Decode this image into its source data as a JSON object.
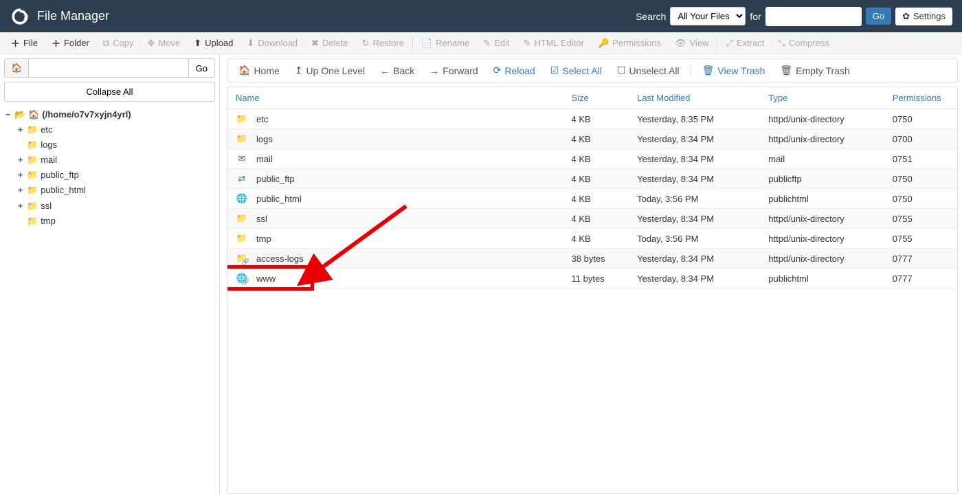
{
  "header": {
    "title": "File Manager",
    "searchLabel": "Search",
    "searchScope": "All Your Files",
    "forLabel": "for",
    "goLabel": "Go",
    "settingsLabel": "Settings"
  },
  "toolbar": {
    "file": "File",
    "folder": "Folder",
    "copy": "Copy",
    "move": "Move",
    "upload": "Upload",
    "download": "Download",
    "delete": "Delete",
    "restore": "Restore",
    "rename": "Rename",
    "edit": "Edit",
    "htmlEditor": "HTML Editor",
    "permissions": "Permissions",
    "view": "View",
    "extract": "Extract",
    "compress": "Compress"
  },
  "sidebar": {
    "goLabel": "Go",
    "collapseLabel": "Collapse All",
    "rootLabel": "(/home/o7v7xyjn4yrl)",
    "tree": [
      {
        "label": "etc",
        "expandable": true
      },
      {
        "label": "logs",
        "expandable": false
      },
      {
        "label": "mail",
        "expandable": true
      },
      {
        "label": "public_ftp",
        "expandable": true
      },
      {
        "label": "public_html",
        "expandable": true
      },
      {
        "label": "ssl",
        "expandable": true
      },
      {
        "label": "tmp",
        "expandable": false
      }
    ]
  },
  "nav": {
    "home": "Home",
    "upOne": "Up One Level",
    "back": "Back",
    "forward": "Forward",
    "reload": "Reload",
    "selectAll": "Select All",
    "unselectAll": "Unselect All",
    "viewTrash": "View Trash",
    "emptyTrash": "Empty Trash"
  },
  "columns": {
    "name": "Name",
    "size": "Size",
    "lastModified": "Last Modified",
    "type": "Type",
    "permissions": "Permissions"
  },
  "rows": [
    {
      "icon": "folder",
      "name": "etc",
      "size": "4 KB",
      "modified": "Yesterday, 8:35 PM",
      "type": "httpd/unix-directory",
      "perm": "0750"
    },
    {
      "icon": "folder",
      "name": "logs",
      "size": "4 KB",
      "modified": "Yesterday, 8:34 PM",
      "type": "httpd/unix-directory",
      "perm": "0700"
    },
    {
      "icon": "mail",
      "name": "mail",
      "size": "4 KB",
      "modified": "Yesterday, 8:34 PM",
      "type": "mail",
      "perm": "0751"
    },
    {
      "icon": "ftp",
      "name": "public_ftp",
      "size": "4 KB",
      "modified": "Yesterday, 8:34 PM",
      "type": "publicftp",
      "perm": "0750"
    },
    {
      "icon": "globe",
      "name": "public_html",
      "size": "4 KB",
      "modified": "Today, 3:56 PM",
      "type": "publichtml",
      "perm": "0750"
    },
    {
      "icon": "folder",
      "name": "ssl",
      "size": "4 KB",
      "modified": "Yesterday, 8:34 PM",
      "type": "httpd/unix-directory",
      "perm": "0755"
    },
    {
      "icon": "folder",
      "name": "tmp",
      "size": "4 KB",
      "modified": "Today, 3:56 PM",
      "type": "httpd/unix-directory",
      "perm": "0755"
    },
    {
      "icon": "folder-link",
      "name": "access-logs",
      "size": "38 bytes",
      "modified": "Yesterday, 8:34 PM",
      "type": "httpd/unix-directory",
      "perm": "0777"
    },
    {
      "icon": "globe-link",
      "name": "www",
      "size": "11 bytes",
      "modified": "Yesterday, 8:34 PM",
      "type": "publichtml",
      "perm": "0777"
    }
  ],
  "annotation": {
    "highlightedRow": 8
  }
}
